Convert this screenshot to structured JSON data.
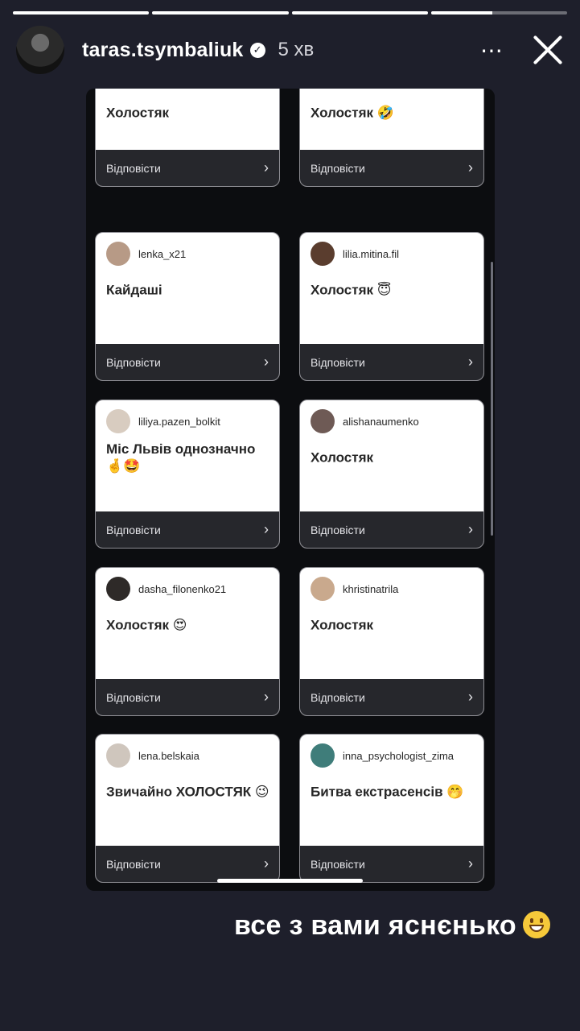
{
  "story": {
    "progress": [
      1,
      1,
      1,
      0.45
    ],
    "user": "taras.tsymbaliuk",
    "time": "5 хв",
    "more_icon": "⋯",
    "caption": "все з вами яснєнько"
  },
  "reply_label": "Відповісти",
  "cards": [
    {
      "username": "",
      "message": "Холостяк",
      "avatar_color": "#8a8a8a"
    },
    {
      "username": "",
      "message": "Холостяк 🤣",
      "avatar_color": "#8a8a8a"
    },
    {
      "username": "lenka_x21",
      "message": "Кайдаші",
      "avatar_color": "#b79a86"
    },
    {
      "username": "lilia.mitina.fil",
      "message": "Холостяк 😇",
      "avatar_color": "#5a3d2e"
    },
    {
      "username": "liliya.pazen_bolkit",
      "message": "Міс Львів однозначно 🤞🤩",
      "avatar_color": "#d8ccc0"
    },
    {
      "username": "alishanaumenko",
      "message": "Холостяк",
      "avatar_color": "#6e5a55"
    },
    {
      "username": "dasha_filonenko21",
      "message": "Холостяк 😍",
      "avatar_color": "#2e2a28"
    },
    {
      "username": "khristinatrila",
      "message": "Холостяк",
      "avatar_color": "#c9a98d"
    },
    {
      "username": "lena.belskaia",
      "message": "Звичайно ХОЛОСТЯК 😉",
      "avatar_color": "#cfc6bd"
    },
    {
      "username": "inna_psychologist_zima",
      "message": "Битва екстрасенсів 🤭",
      "avatar_color": "#3f7d7a"
    }
  ]
}
